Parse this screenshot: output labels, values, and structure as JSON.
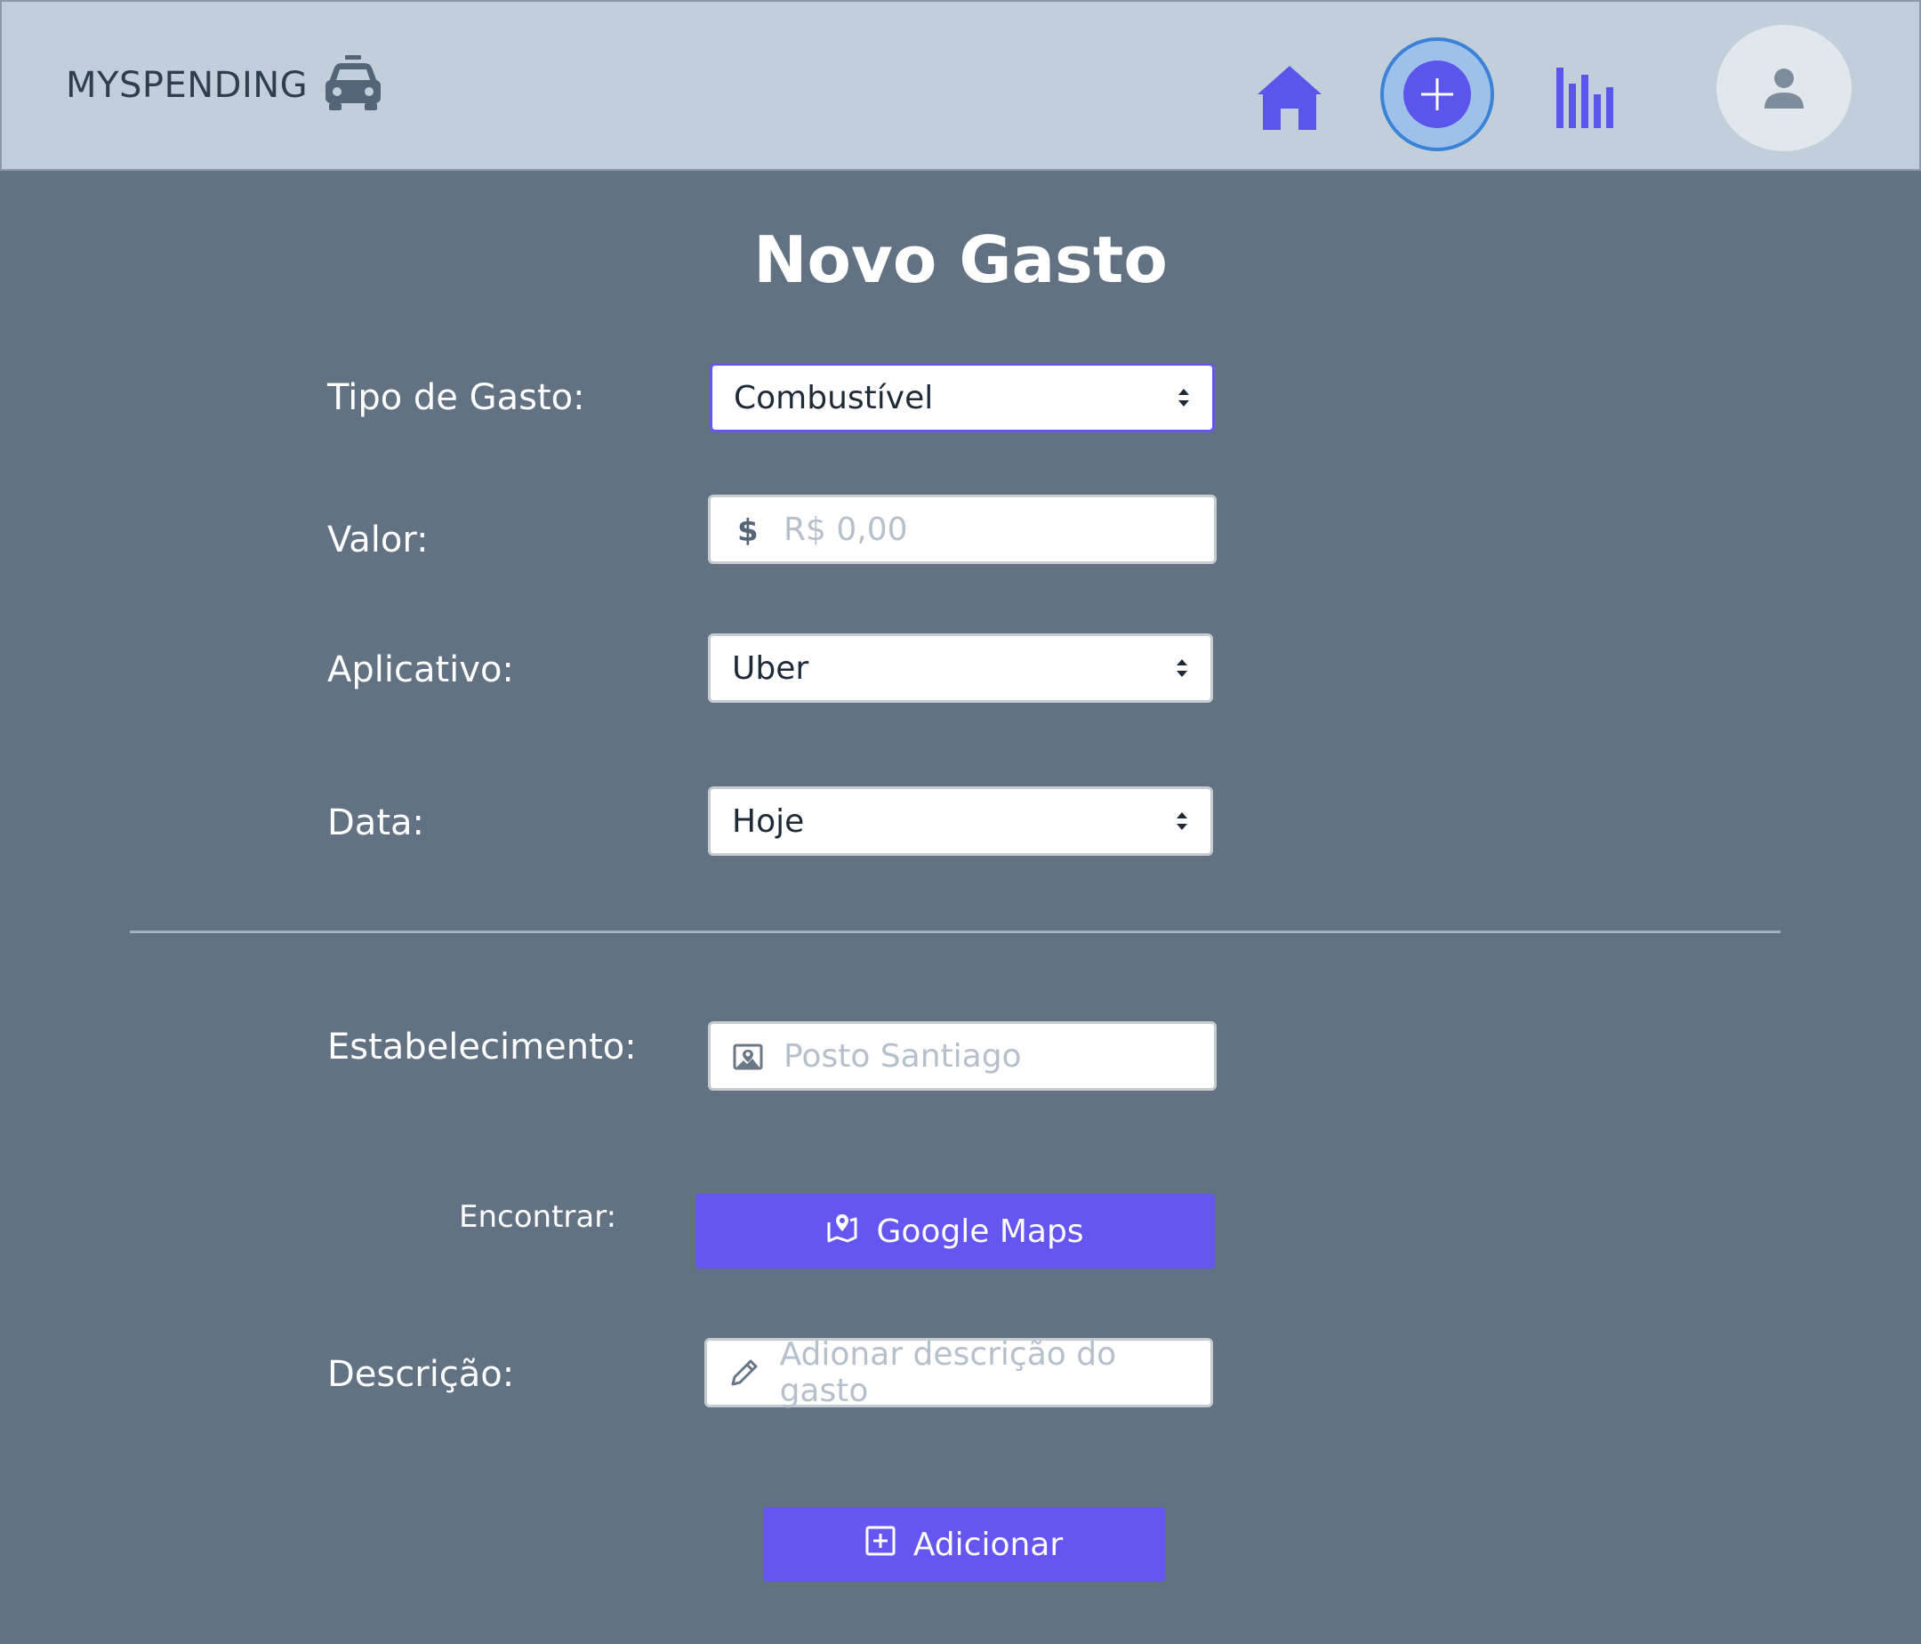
{
  "header": {
    "brand": "MYSPENDING",
    "brand_icon": "taxi-icon",
    "nav": [
      {
        "name": "home",
        "icon": "home-icon"
      },
      {
        "name": "add",
        "icon": "plus-circle-icon",
        "active": true
      },
      {
        "name": "stats",
        "icon": "bar-chart-icon"
      }
    ],
    "avatar_icon": "user-icon"
  },
  "page": {
    "title": "Novo Gasto"
  },
  "form": {
    "tipo": {
      "label": "Tipo de Gasto:",
      "value": "Combustível"
    },
    "valor": {
      "label": "Valor:",
      "placeholder": "R$ 0,00",
      "icon": "dollar-icon"
    },
    "aplicativo": {
      "label": "Aplicativo:",
      "value": "Uber"
    },
    "data": {
      "label": "Data:",
      "value": "Hoje"
    },
    "estabelecimento": {
      "label": "Estabelecimento:",
      "placeholder": "Posto Santiago",
      "icon": "map-image-icon"
    },
    "encontrar": {
      "label": "Encontrar:",
      "button": "Google Maps",
      "icon": "map-pin-icon"
    },
    "descricao": {
      "label": "Descrição:",
      "placeholder": "Adionar descrição do gasto",
      "icon": "pencil-icon"
    },
    "submit": {
      "label": "Adicionar",
      "icon": "plus-square-icon"
    }
  },
  "colors": {
    "accent": "#6656f0",
    "background": "#637282",
    "header": "#c2cfdb"
  }
}
